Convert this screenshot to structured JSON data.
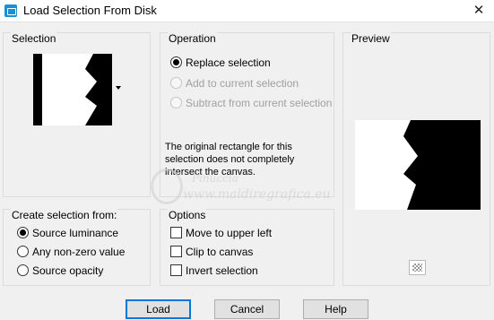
{
  "window": {
    "title": "Load Selection From Disk",
    "close_glyph": "✕"
  },
  "selection": {
    "title": "Selection"
  },
  "operation": {
    "title": "Operation",
    "options": [
      {
        "label": "Replace selection",
        "checked": true,
        "enabled": true
      },
      {
        "label": "Add to current selection",
        "checked": false,
        "enabled": false
      },
      {
        "label": "Subtract from current selection",
        "checked": false,
        "enabled": false
      }
    ],
    "note": "The original rectangle for this selection does not completely intersect the canvas."
  },
  "preview": {
    "title": "Preview"
  },
  "create_from": {
    "title": "Create selection from:",
    "options": [
      {
        "label": "Source luminance",
        "checked": true
      },
      {
        "label": "Any non-zero value",
        "checked": false
      },
      {
        "label": "Source opacity",
        "checked": false
      }
    ]
  },
  "options": {
    "title": "Options",
    "items": [
      {
        "label": "Move to upper left",
        "checked": false
      },
      {
        "label": "Clip to canvas",
        "checked": false
      },
      {
        "label": "Invert selection",
        "checked": false
      }
    ]
  },
  "buttons": {
    "load": "Load",
    "cancel": "Cancel",
    "help": "Help"
  },
  "watermark": {
    "line1": "Pinuccia",
    "line2": "www.maldiregrafica.eu"
  }
}
